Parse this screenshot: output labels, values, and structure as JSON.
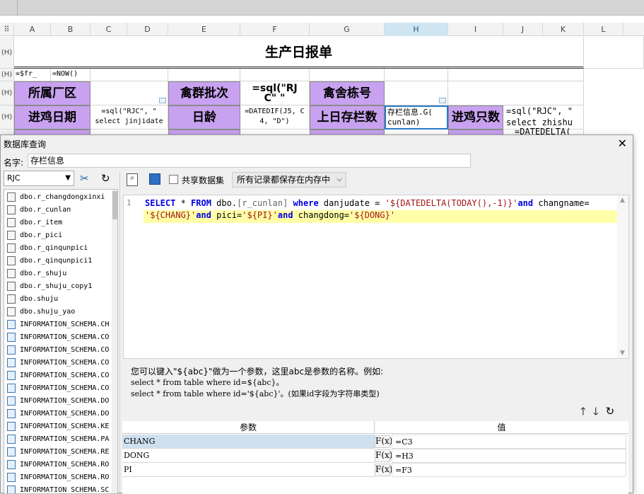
{
  "columns": [
    "A",
    "B",
    "C",
    "D",
    "E",
    "F",
    "G",
    "H",
    "I",
    "J",
    "K",
    "L"
  ],
  "row_marker": "(H)",
  "sheet": {
    "title": "生产日报单",
    "r2_a": "=$fr_",
    "r2_b": "=NOW()",
    "label_factory": "所属厂区",
    "label_batch": "禽群批次",
    "formula_f3_1": "=sql(\"RJ",
    "formula_f3_2": "C\"  \"",
    "label_house": "禽舍栋号",
    "label_date": "进鸡日期",
    "formula_c4_1": "=sql(\"RJC\", \"",
    "formula_c4_2": "select jinjidate",
    "label_age": "日龄",
    "formula_f4_1": "=DATEDIF(J5, C",
    "formula_f4_2": "4, \"D\")",
    "label_stock": "上日存栏数",
    "cell_h4_1": "存栏信息.G(",
    "cell_h4_2": "cunlan)",
    "label_count": "进鸡只数",
    "formula_j4_1": "=sql(\"RJC\", \"",
    "formula_j4_2": "select zhishu",
    "formula_j5": "=DATEDELTA("
  },
  "dialog": {
    "title": "数据库查询",
    "close": "✕",
    "name_label": "名字:",
    "name_value": "存栏信息",
    "db_value": "RJC",
    "share_label": "共享数据集",
    "memory_option": "所有记录都保存在内存中",
    "tables": [
      "dbo.r_changdongxinxi",
      "dbo.r_cunlan",
      "dbo.r_item",
      "dbo.r_pici",
      "dbo.r_qinqunpici",
      "dbo.r_qinqunpici1",
      "dbo.r_shuju",
      "dbo.r_shuju_copy1",
      "dbo.shuju",
      "dbo.shuju_yao"
    ],
    "sys_tables": [
      "INFORMATION_SCHEMA.CH",
      "INFORMATION_SCHEMA.CO",
      "INFORMATION_SCHEMA.CO",
      "INFORMATION_SCHEMA.CO",
      "INFORMATION_SCHEMA.CO",
      "INFORMATION_SCHEMA.CO",
      "INFORMATION_SCHEMA.DO",
      "INFORMATION_SCHEMA.DO",
      "INFORMATION_SCHEMA.KE",
      "INFORMATION_SCHEMA.PA",
      "INFORMATION_SCHEMA.RE",
      "INFORMATION_SCHEMA.RO",
      "INFORMATION_SCHEMA.RO",
      "INFORMATION_SCHEMA.SC"
    ],
    "line_number": "1",
    "sql": {
      "k1": "SELECT",
      "t1": " * ",
      "k2": "FROM",
      "t2": " dbo.",
      "t3": "[r_cunlan]",
      "k3": " where",
      "t4": " danjudate = ",
      "s1": "'${DATEDELTA(TODAY(),-1)}'",
      "k4": "and",
      "t5": " changname=",
      "s2": "'${CHANG}'",
      "k5": "and",
      "t6": " pici=",
      "s3": "'${PI}'",
      "k6": "and",
      "t7": " changdong=",
      "s4": "'${DONG}'"
    },
    "help_line1": "您可以键入\"${abc}\"做为一个参数，这里abc是参数的名称。例如:",
    "help_line2": "select * from table where id=${abc}。",
    "help_line3": "select * from table where id='${abc}'。(如果id字段为字符串类型)",
    "param_header": "参数",
    "value_header": "值",
    "params": [
      {
        "name": "CHANG",
        "value": "=C3"
      },
      {
        "name": "DONG",
        "value": "=H3"
      },
      {
        "name": "PI",
        "value": "=F3"
      }
    ],
    "fx_label": "F(x)"
  },
  "colors": {
    "purple": "#c8a2f0",
    "highlight": "#ffffa8",
    "keyword": "#0000e0",
    "string": "#a31515"
  }
}
